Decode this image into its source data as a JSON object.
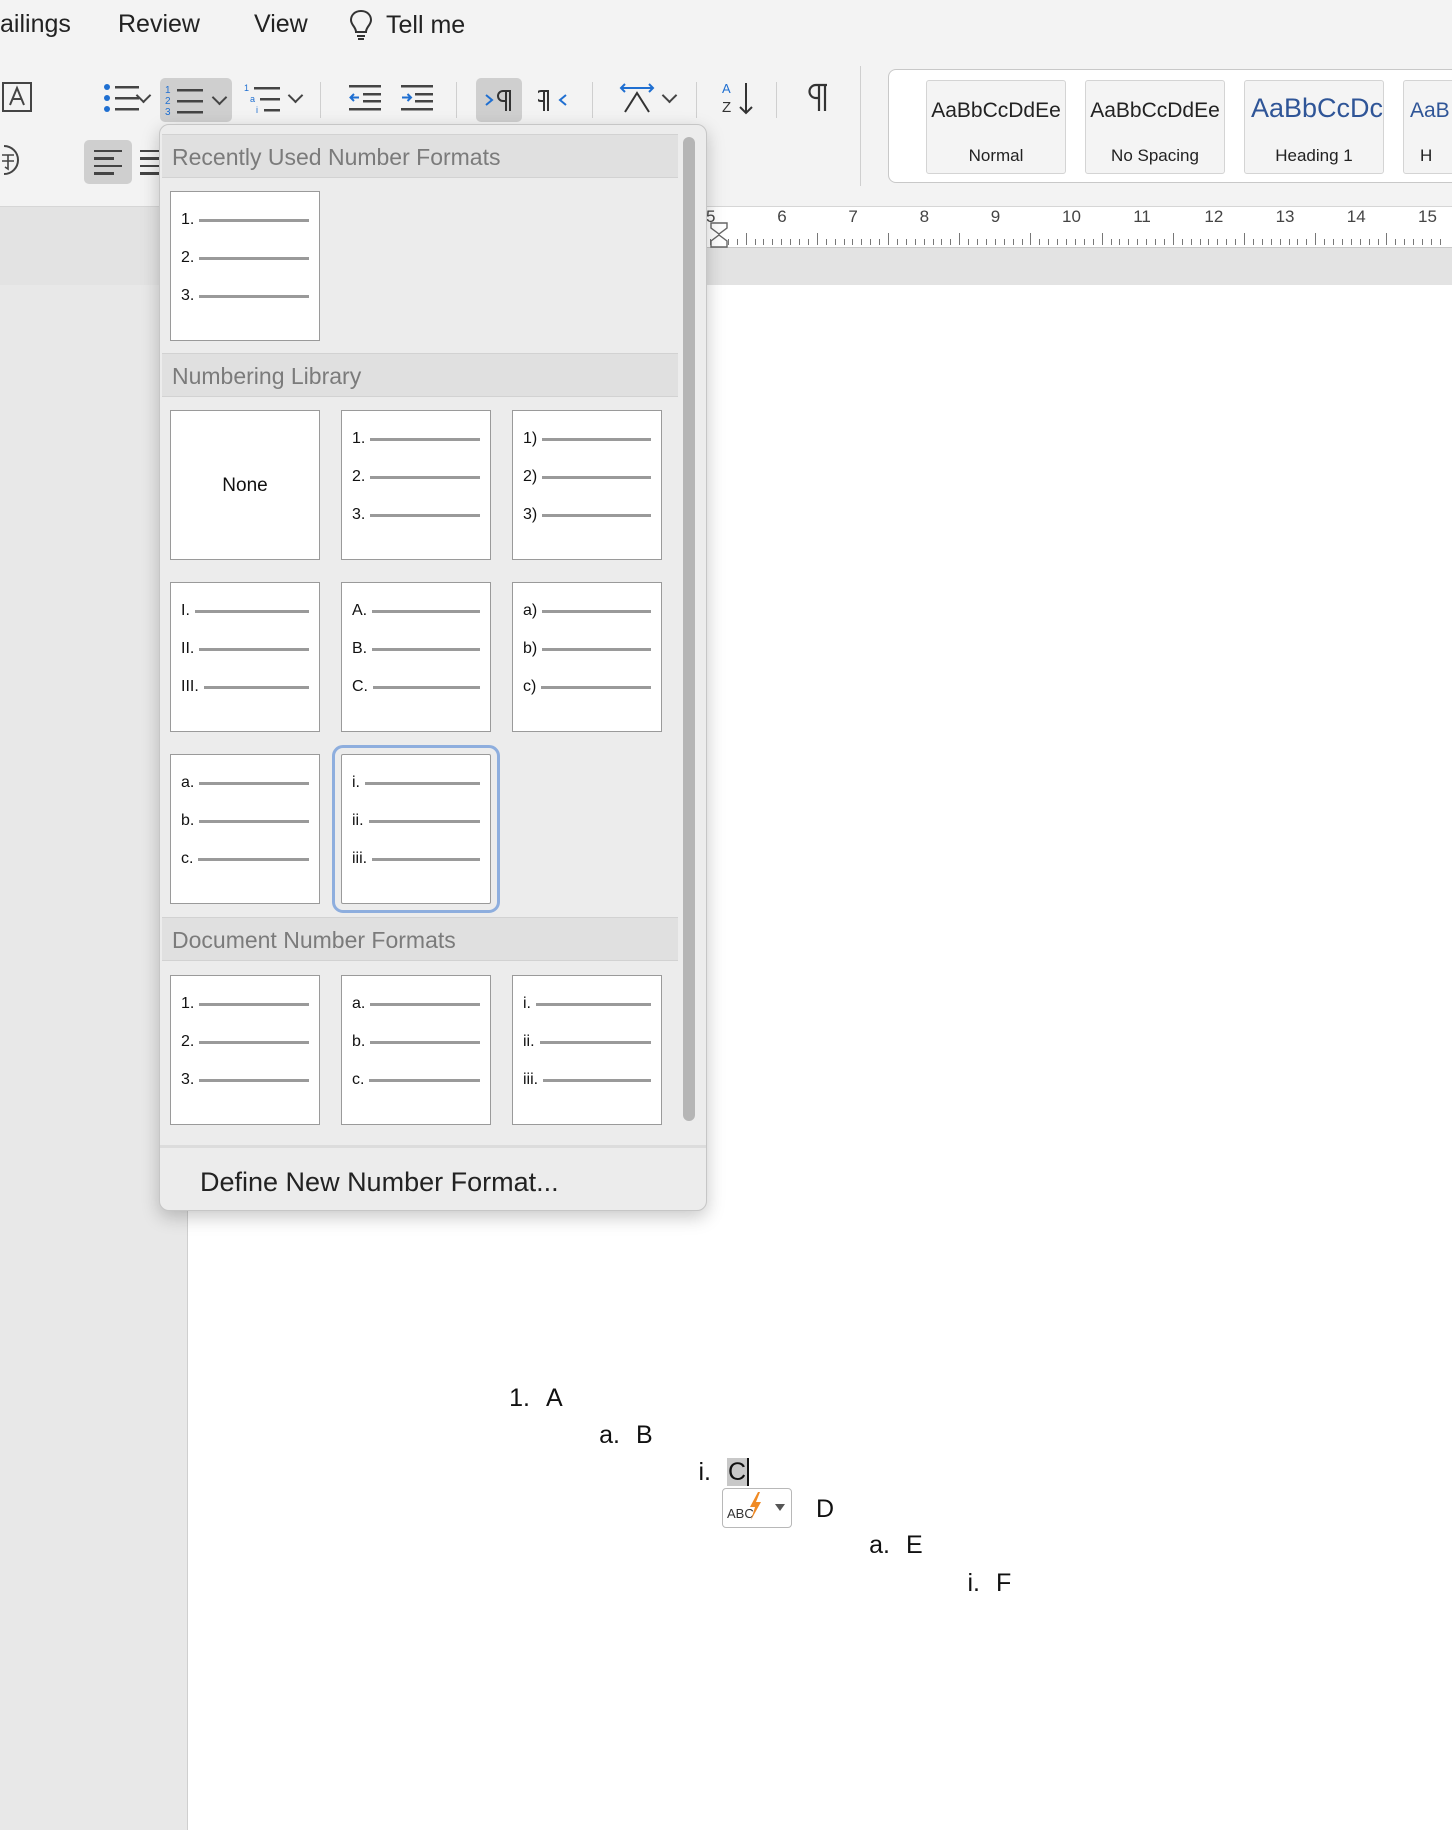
{
  "menu": {
    "tabs": [
      "ailings",
      "Review",
      "View"
    ],
    "tell_me": "Tell me"
  },
  "styles": [
    {
      "sample": "AaBbCcDdEe",
      "name": "Normal"
    },
    {
      "sample": "AaBbCcDdEe",
      "name": "No Spacing"
    },
    {
      "sample": "AaBbCcDc",
      "name": "Heading 1"
    },
    {
      "sample": "AaB",
      "name": "H"
    }
  ],
  "ruler": {
    "labels": [
      "5",
      "6",
      "7",
      "8",
      "9",
      "10",
      "11",
      "12",
      "13",
      "14",
      "15"
    ]
  },
  "dropdown": {
    "recent_header": "Recently Used Number Formats",
    "library_header": "Numbering Library",
    "document_header": "Document Number Formats",
    "none_label": "None",
    "recent": [
      [
        "1.",
        "2.",
        "3."
      ]
    ],
    "library": [
      null,
      [
        "1.",
        "2.",
        "3."
      ],
      [
        "1)",
        "2)",
        "3)"
      ],
      [
        "I.",
        "II.",
        "III."
      ],
      [
        "A.",
        "B.",
        "C."
      ],
      [
        "a)",
        "b)",
        "c)"
      ],
      [
        "a.",
        "b.",
        "c."
      ],
      [
        "i.",
        "ii.",
        "iii."
      ]
    ],
    "library_selected_index": 7,
    "document": [
      [
        "1.",
        "2.",
        "3."
      ],
      [
        "a.",
        "b.",
        "c."
      ],
      [
        "i.",
        "ii.",
        "iii."
      ]
    ],
    "define_label": "Define New Number Format..."
  },
  "document": {
    "items": [
      {
        "number": "1.",
        "text": "A"
      },
      {
        "number": "a.",
        "text": "B"
      },
      {
        "number": "i.",
        "text": "C"
      },
      {
        "number": "",
        "text": "D"
      },
      {
        "number": "a.",
        "text": "E"
      },
      {
        "number": "i.",
        "text": "F"
      }
    ],
    "autocorrect_label": "ABC"
  }
}
